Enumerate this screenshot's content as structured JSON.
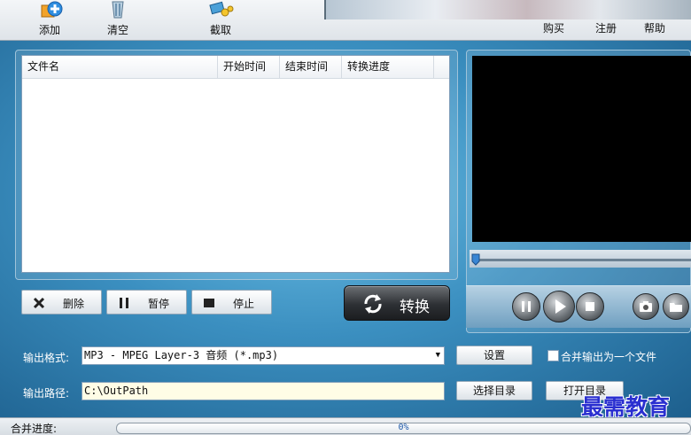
{
  "toolbar": {
    "add_label": "添加",
    "clear_label": "清空",
    "capture_label": "截取",
    "buy_label": "购买",
    "register_label": "注册",
    "help_label": "帮助"
  },
  "file_list": {
    "columns": [
      "文件名",
      "开始时间",
      "结束时间",
      "转换进度"
    ]
  },
  "controls": {
    "delete_label": "删除",
    "pause_label": "暂停",
    "stop_label": "停止",
    "convert_label": "转换"
  },
  "settings": {
    "format_label": "输出格式:",
    "format_value": "MP3 - MPEG Layer-3 音频 (*.mp3)",
    "settings_button": "设置",
    "merge_label": "合并输出为一个文件",
    "merge_checked": false,
    "path_label": "输出路径:",
    "path_value": "C:\\OutPath",
    "choose_dir_button": "选择目录",
    "open_dir_button": "打开目录"
  },
  "status": {
    "merge_progress_label": "合并进度:",
    "progress_value": 0,
    "progress_text": "0%"
  },
  "watermark": "最需教育",
  "colors": {
    "accent": "#3b8fc0",
    "video_bg": "#000000",
    "progress_text": "#1b56a6"
  },
  "icons": [
    "add-icon",
    "clear-icon",
    "capture-icon",
    "delete-icon",
    "pause-icon",
    "stop-icon",
    "convert-icon",
    "play-pause-icon",
    "play-icon",
    "stop-round-icon",
    "snapshot-icon",
    "open-folder-icon"
  ]
}
